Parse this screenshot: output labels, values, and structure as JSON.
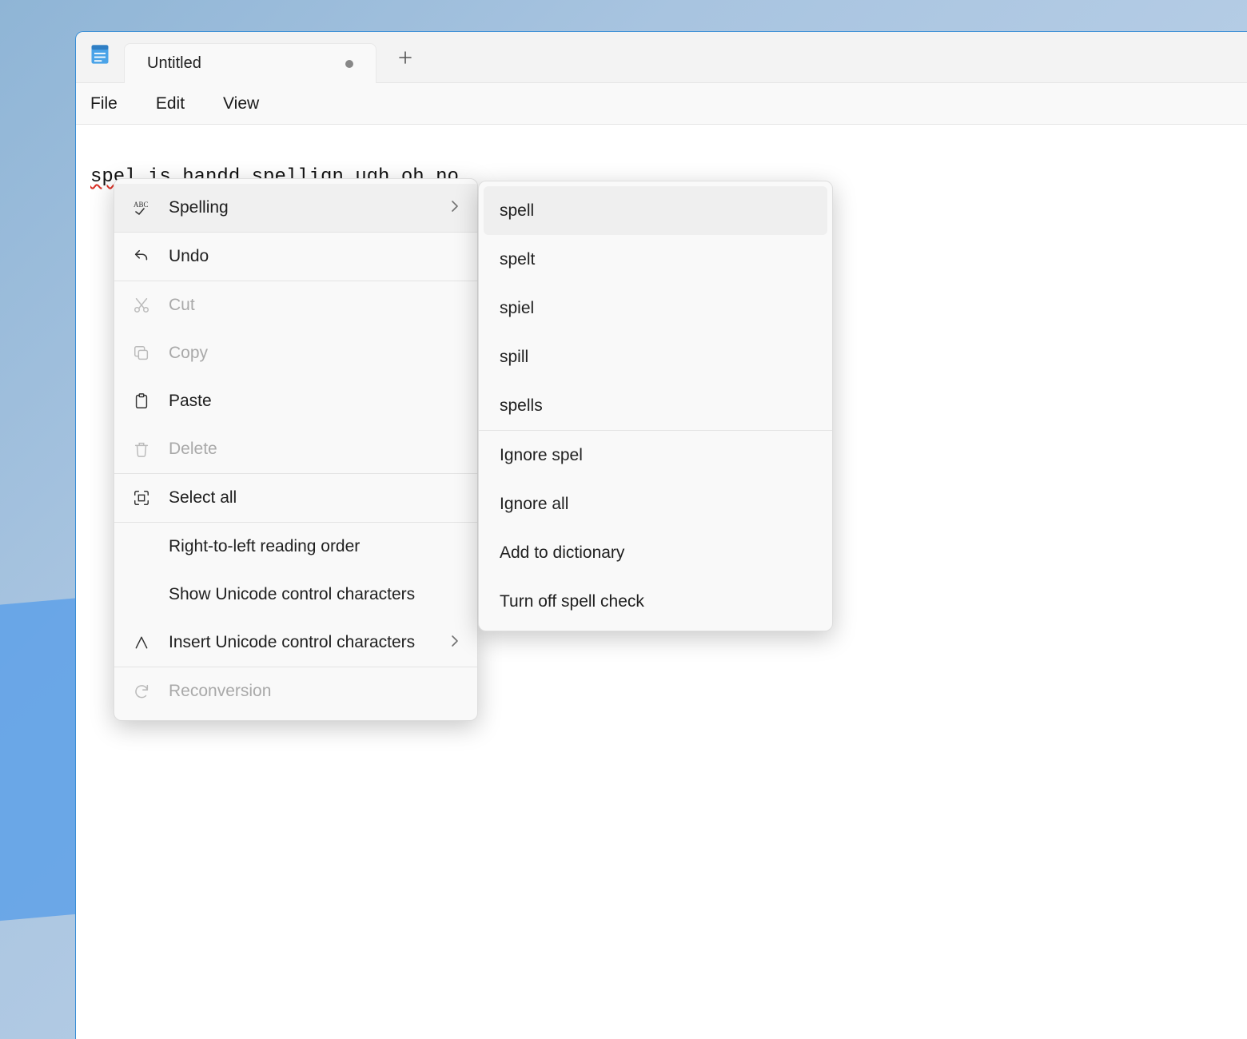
{
  "tab": {
    "title": "Untitled",
    "dirty": true
  },
  "menubar": {
    "file": "File",
    "edit": "Edit",
    "view": "View"
  },
  "editor": {
    "misspelled_word": "spel",
    "text_rest": " is handd spellign ugh oh no"
  },
  "context_menu": {
    "spelling": "Spelling",
    "undo": "Undo",
    "cut": "Cut",
    "copy": "Copy",
    "paste": "Paste",
    "delete": "Delete",
    "select_all": "Select all",
    "rtl": "Right-to-left reading order",
    "show_unicode": "Show Unicode control characters",
    "insert_unicode": "Insert Unicode control characters",
    "reconversion": "Reconversion"
  },
  "spelling_submenu": {
    "suggestions": [
      "spell",
      "spelt",
      "spiel",
      "spill",
      "spells"
    ],
    "ignore_word": "Ignore spel",
    "ignore_all": "Ignore all",
    "add_to_dictionary": "Add to dictionary",
    "turn_off": "Turn off spell check"
  }
}
